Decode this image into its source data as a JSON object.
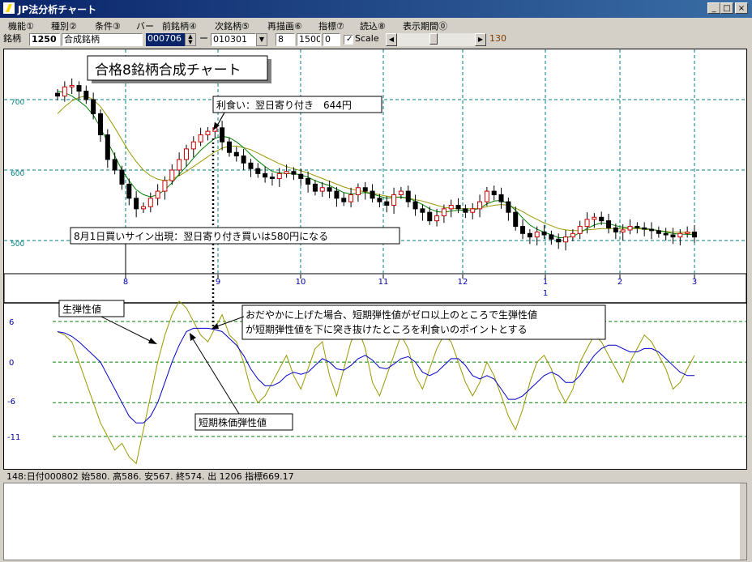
{
  "window": {
    "title": "JP法分析チャート",
    "minimize_glyph": "_",
    "maximize_glyph": "□",
    "close_glyph": "×"
  },
  "menu": [
    "機能①",
    "種別②",
    "条件③",
    "バー",
    "前銘柄④",
    "次銘柄⑤",
    "再描画⑥",
    "指標⑦",
    "読込⑧",
    "表示期間⓪"
  ],
  "toolbar": {
    "code_label": "銘柄",
    "code_value": "1250",
    "name_value": "合成銘柄",
    "date_value": "000706",
    "dash": "ー",
    "start_value": "010301",
    "p1": "8",
    "p2": "1500",
    "p3": "0",
    "checkbox_mark": "✓",
    "scale_label": "Scale",
    "scroll_left": "◀",
    "scroll_right": "▶",
    "scale_value": "130"
  },
  "annotations": {
    "title": "合格8銘柄合成チャート",
    "take_profit": "利食い：翌日寄り付き　644円",
    "buy_signal": "8月1日買いサイン出現：翌日寄り付き買いは580円になる",
    "raw_label": "生弾性値",
    "short_label": "短期株価弾性値",
    "note_line1": "おだやかに上げた場合、短期弾性値がゼロ以上のところで生弾性値",
    "note_line2": "が短期弾性値を下に突き抜けたところを利食いのポイントとする"
  },
  "status": "148:日付000802 始580. 高586. 安567. 終574. 出 1206 指標669.17",
  "colors": {
    "grid_teal": "#008080",
    "grid_green": "#008000",
    "ma_short": "#008000",
    "ma_long": "#999900",
    "candle": "#000000",
    "candle_up": "#cc0000",
    "raw_line": "#999900",
    "short_line": "#0000cc"
  },
  "chart_data": [
    {
      "type": "candlestick",
      "y_ticks": [
        "700",
        "600",
        "500"
      ],
      "y_range": [
        470,
        760
      ],
      "x_ticks": [
        "8",
        "9",
        "10",
        "11",
        "12",
        "1",
        "2",
        "3"
      ],
      "x_sub_label": "1",
      "close": [
        705,
        718,
        720,
        712,
        700,
        680,
        650,
        615,
        600,
        580,
        560,
        545,
        548,
        560,
        570,
        585,
        600,
        615,
        630,
        640,
        650,
        655,
        660,
        640,
        625,
        620,
        610,
        602,
        595,
        590,
        588,
        595,
        598,
        594,
        588,
        580,
        570,
        575,
        570,
        560,
        555,
        565,
        575,
        570,
        560,
        555,
        550,
        565,
        570,
        555,
        545,
        540,
        528,
        535,
        545,
        550,
        545,
        540,
        545,
        555,
        570,
        565,
        555,
        540,
        520,
        510,
        505,
        512,
        508,
        502,
        498,
        505,
        510,
        520,
        530,
        533,
        528,
        518,
        512,
        515,
        520,
        518,
        516,
        514,
        510,
        508,
        505,
        510,
        512,
        505
      ],
      "ma_short": [
        712,
        710,
        705,
        698,
        690,
        678,
        660,
        640,
        620,
        600,
        585,
        572,
        565,
        562,
        565,
        572,
        582,
        594,
        605,
        617,
        628,
        637,
        645,
        648,
        646,
        640,
        632,
        622,
        613,
        605,
        598,
        596,
        595,
        595,
        593,
        590,
        585,
        581,
        578,
        573,
        568,
        566,
        567,
        568,
        566,
        563,
        560,
        561,
        562,
        560,
        556,
        551,
        545,
        541,
        540,
        542,
        543,
        543,
        543,
        546,
        552,
        556,
        557,
        552,
        543,
        532,
        522,
        516,
        512,
        508,
        504,
        504,
        506,
        511,
        517,
        522,
        525,
        524,
        521,
        519,
        518,
        518,
        517,
        516,
        514,
        512,
        510,
        509,
        509,
        508
      ],
      "ma_long": [
        680,
        690,
        698,
        703,
        705,
        700,
        690,
        676,
        660,
        643,
        626,
        612,
        600,
        592,
        587,
        585,
        587,
        592,
        598,
        605,
        612,
        619,
        626,
        631,
        634,
        634,
        632,
        629,
        624,
        619,
        614,
        609,
        605,
        602,
        599,
        596,
        592,
        588,
        584,
        580,
        576,
        573,
        571,
        569,
        567,
        565,
        563,
        562,
        561,
        560,
        558,
        556,
        553,
        550,
        547,
        546,
        545,
        545,
        545,
        546,
        548,
        550,
        551,
        550,
        546,
        541,
        535,
        530,
        525,
        521,
        517,
        515,
        514,
        514,
        515,
        516,
        517,
        517,
        517,
        517,
        517,
        517,
        516,
        515,
        514,
        513,
        512,
        512,
        511,
        510
      ]
    },
    {
      "type": "line",
      "y_ticks": [
        "6",
        "0",
        "-6",
        "-11"
      ],
      "y_range": [
        -16,
        10
      ],
      "series": [
        {
          "name": "生弾性値",
          "values": [
            4.5,
            4,
            3,
            0,
            -3,
            -6,
            -9,
            -11,
            -13,
            -12,
            -14,
            -15,
            -10,
            -5,
            0,
            4,
            7,
            9,
            8,
            6,
            4,
            3,
            5,
            7,
            4,
            3,
            0,
            -4,
            -6,
            -5,
            -3,
            -1,
            1,
            -2,
            -4,
            -1,
            2,
            3,
            -2,
            -5,
            -1,
            3,
            5,
            2,
            -3,
            -5,
            -2,
            1,
            4,
            2,
            -2,
            -4,
            -1,
            2,
            4,
            3,
            0,
            -3,
            -5,
            -3,
            0,
            -2,
            -5,
            -8,
            -10,
            -7,
            -3,
            0,
            1,
            -1,
            -4,
            -6,
            -4,
            0,
            2,
            4,
            3,
            1,
            -1,
            -3,
            0,
            2,
            4,
            3,
            1,
            -1,
            -4,
            -3,
            -1,
            1
          ]
        },
        {
          "name": "短期株価弾性値",
          "values": [
            4.5,
            4.3,
            3.8,
            3,
            2,
            1,
            0,
            -2,
            -4,
            -6,
            -8,
            -9,
            -9,
            -8,
            -6,
            -3,
            0,
            2.5,
            4.5,
            5,
            5,
            5,
            4.8,
            4.5,
            3.5,
            2.5,
            1,
            -1,
            -2.5,
            -3.5,
            -3.5,
            -3,
            -2,
            -1.5,
            -1.8,
            -1.5,
            -0.5,
            0.5,
            0,
            -1,
            -1.2,
            -0.5,
            0.5,
            1,
            0.3,
            -0.8,
            -1,
            -0.3,
            0.5,
            0.8,
            0,
            -1.5,
            -2,
            -1.5,
            -0.5,
            0.5,
            0.5,
            -0.5,
            -2,
            -2.5,
            -2,
            -2.5,
            -4,
            -5.5,
            -5.5,
            -5,
            -4,
            -3,
            -2,
            -1.5,
            -2,
            -3,
            -3,
            -2,
            -0.5,
            1,
            2,
            2.5,
            2.5,
            2,
            1.5,
            1.5,
            2,
            2,
            1.5,
            0.5,
            -0.5,
            -1.5,
            -2,
            -2
          ]
        }
      ]
    }
  ]
}
